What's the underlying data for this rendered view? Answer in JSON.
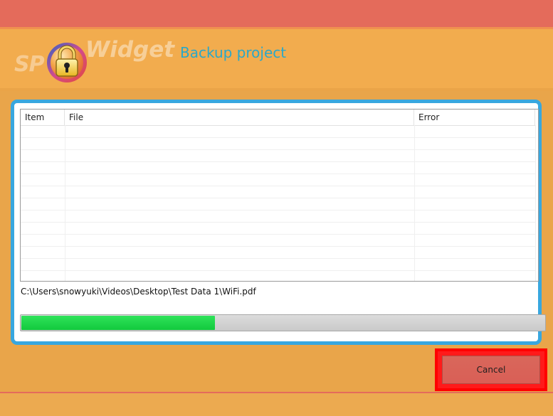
{
  "header": {
    "logo_left": "SP",
    "logo_right": "Widget",
    "title": "Backup project"
  },
  "table": {
    "columns": [
      "Item",
      "File",
      "Error"
    ],
    "rows": []
  },
  "status": {
    "current_file": "C:\\Users\\snowyuki\\Videos\\Desktop\\Test Data 1\\WiFi.pdf",
    "progress_fraction": 0.37
  },
  "footer": {
    "cancel_label": "Cancel"
  },
  "colors": {
    "title": "#2aa8c9",
    "panel_border": "#38a7df",
    "progress": "#12c93d",
    "highlight": "#ff0000"
  },
  "icons": {
    "logo": "lock-icon"
  }
}
